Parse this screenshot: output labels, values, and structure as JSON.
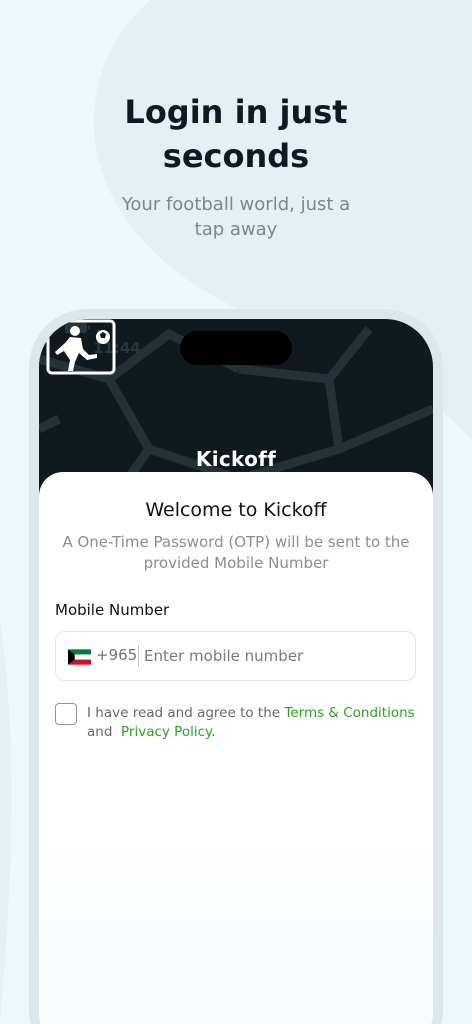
{
  "promo": {
    "title_line1": "Login in just",
    "title_line2": "seconds",
    "subtitle_line1": "Your football world, just a",
    "subtitle_line2": "tap away"
  },
  "status_bar": {
    "time": "11:44"
  },
  "brand": {
    "logo_text": "Kickoff"
  },
  "login": {
    "title": "Welcome to Kickoff",
    "description_line1": "A One-Time Password (OTP) will be sent to the",
    "description_line2": "provided Mobile Number",
    "mobile_label": "Mobile Number",
    "country_code": "+965",
    "mobile_placeholder": "Enter mobile number",
    "mobile_value": "",
    "terms_prefix": "I have read and agree to the",
    "terms_link": "Terms & Conditions",
    "terms_and": "and",
    "privacy_link": "Privacy Policy.",
    "agree_checked": false
  },
  "icons": {
    "flag": "kuwait-flag-icon",
    "logo": "football-player-icon",
    "wifi": "wifi-icon",
    "battery": "battery-icon"
  },
  "colors": {
    "accent_green": "#2aa61d",
    "header_dark": "#0f191e",
    "background": "#eef7fa"
  }
}
